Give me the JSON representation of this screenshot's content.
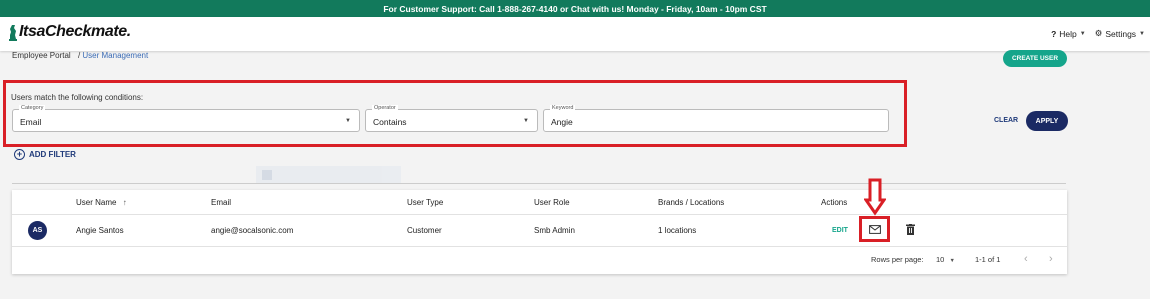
{
  "banner": {
    "text": "For Customer Support: Call 1-888-267-4140 or Chat with us! Monday - Friday, 10am - 10pm CST"
  },
  "header": {
    "logo_text": "ItsaCheckmate.",
    "help_label": "Help",
    "settings_label": "Settings"
  },
  "breadcrumb": {
    "root": "Employee Portal",
    "separator": "/",
    "current": "User Management"
  },
  "actions": {
    "create_user": "CREATE USER",
    "clear": "CLEAR",
    "apply": "APPLY",
    "add_filter": "ADD FILTER"
  },
  "filter": {
    "title": "Users match the following conditions:",
    "category": {
      "label": "Category",
      "value": "Email"
    },
    "operator": {
      "label": "Operator",
      "value": "Contains"
    },
    "keyword": {
      "label": "Keyword",
      "value": "Angie"
    }
  },
  "table": {
    "columns": [
      "User Name",
      "Email",
      "User Type",
      "User Role",
      "Brands / Locations",
      "Actions"
    ],
    "sort_indicator": "↑",
    "rows": [
      {
        "initials": "AS",
        "name": "Angie Santos",
        "email": "angie@socalsonic.com",
        "type": "Customer",
        "role": "Smb Admin",
        "locations": "1 locations",
        "edit_label": "EDIT"
      }
    ],
    "footer": {
      "rows_per_page_label": "Rows per page:",
      "rows_per_page": "10",
      "range": "1-1 of 1"
    }
  },
  "colors": {
    "brand": "#127a5c",
    "accent": "#15a58b",
    "navy": "#1b2a64",
    "highlight": "#d91f26"
  },
  "icons": [
    "help-icon",
    "gear-icon",
    "plus-circle-icon",
    "sort-up-icon",
    "mail-icon",
    "trash-icon",
    "chevron-left-icon",
    "chevron-right-icon",
    "red-down-arrow"
  ]
}
